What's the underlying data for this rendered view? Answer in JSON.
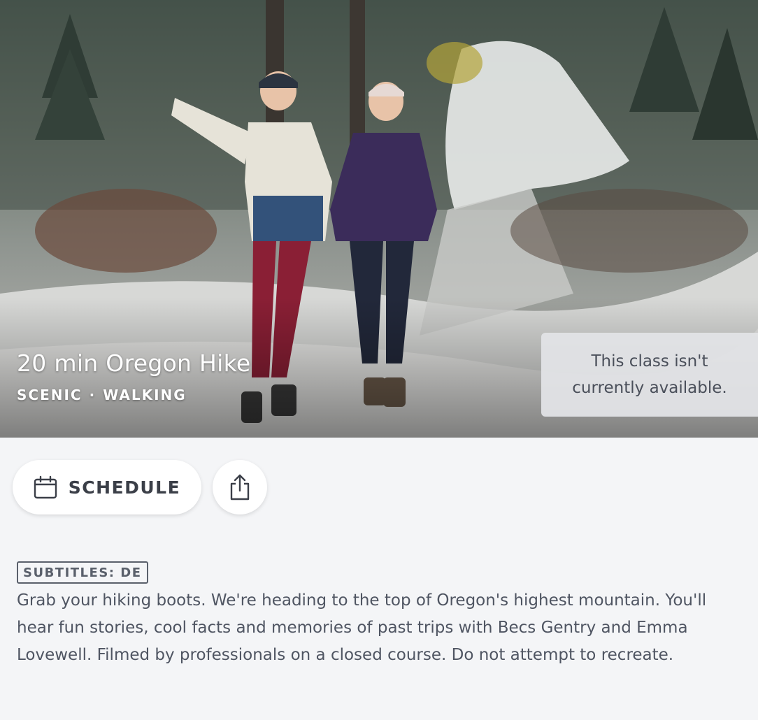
{
  "class": {
    "title": "20 min Oregon Hike",
    "tags": [
      "SCENIC",
      "WALKING"
    ],
    "separator": "·",
    "availability_message": "This class isn't currently available."
  },
  "actions": {
    "schedule_label": "SCHEDULE",
    "schedule_icon": "calendar-icon",
    "share_icon": "share-icon"
  },
  "subtitles_badge": "SUBTITLES: DE",
  "description": "Grab your hiking boots. We're heading to the top of Oregon's highest mountain. You'll hear fun stories, cool facts and memories of past trips with Becs Gentry and Emma Lovewell. Filmed by professionals on a closed course. Do not attempt to recreate.",
  "colors": {
    "page_background": "#f4f5f7",
    "text_primary": "#3b3f48",
    "text_body": "#4f5562",
    "overlay": "#e2e3e6"
  }
}
